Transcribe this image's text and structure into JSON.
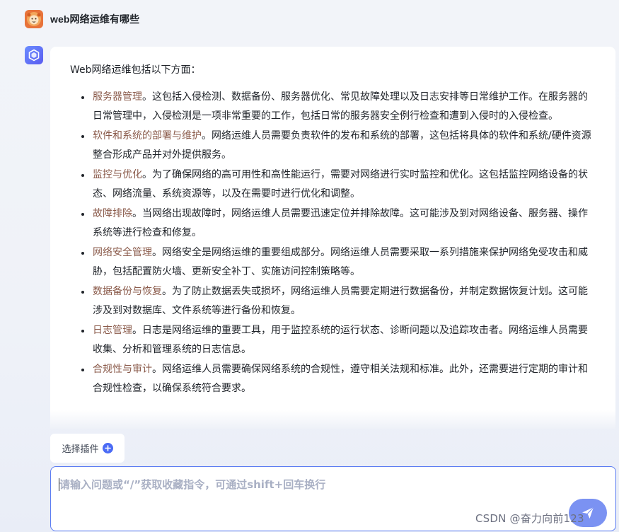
{
  "conversation": {
    "question": "web网络运维有哪些",
    "answer": {
      "intro": "Web网络运维包括以下方面：",
      "points": [
        {
          "title": "服务器管理",
          "text": "。这包括入侵检测、数据备份、服务器优化、常见故障处理以及日志安排等日常维护工作。在服务器的日常管理中，入侵检测是一项非常重要的工作，包括日常的服务器安全例行检查和遭到入侵时的入侵检查。"
        },
        {
          "title": "软件和系统的部署与维护",
          "text": "。网络运维人员需要负责软件的发布和系统的部署，这包括将具体的软件和系统/硬件资源整合形成产品并对外提供服务。"
        },
        {
          "title": "监控与优化",
          "text": "。为了确保网络的高可用性和高性能运行，需要对网络进行实时监控和优化。这包括监控网络设备的状态、网络流量、系统资源等，以及在需要时进行优化和调整。"
        },
        {
          "title": "故障排除",
          "text": "。当网络出现故障时，网络运维人员需要迅速定位并排除故障。这可能涉及到对网络设备、服务器、操作系统等进行检查和修复。"
        },
        {
          "title": "网络安全管理",
          "text": "。网络安全是网络运维的重要组成部分。网络运维人员需要采取一系列措施来保护网络免受攻击和威胁，包括配置防火墙、更新安全补丁、实施访问控制策略等。"
        },
        {
          "title": "数据备份与恢复",
          "text": "。为了防止数据丢失或损坏，网络运维人员需要定期进行数据备份，并制定数据恢复计划。这可能涉及到对数据库、文件系统等进行备份和恢复。"
        },
        {
          "title": "日志管理",
          "text": "。日志是网络运维的重要工具，用于监控系统的运行状态、诊断问题以及追踪攻击者。网络运维人员需要收集、分析和管理系统的日志信息。"
        },
        {
          "title": "合规性与审计",
          "text": "。网络运维人员需要确保网络系统的合规性，遵守相关法规和标准。此外，还需要进行定期的审计和合规性检查，以确保系统符合要求。"
        }
      ]
    }
  },
  "composer": {
    "plugin_label": "选择插件",
    "placeholder": "请输入问题或“/”获取收藏指令，可通过shift+回车换行",
    "value": ""
  },
  "icons": {
    "user_avatar": "lion-avatar-icon",
    "bot_avatar": "cube-logo-icon",
    "plugin_add": "plus-circle-icon",
    "send": "send-plane-icon"
  },
  "colors": {
    "accent": "#5b7cf2",
    "point_title": "#8a5a4a",
    "user_avatar_bg": "#e8733a"
  },
  "watermark": "CSDN @奋力向前123"
}
